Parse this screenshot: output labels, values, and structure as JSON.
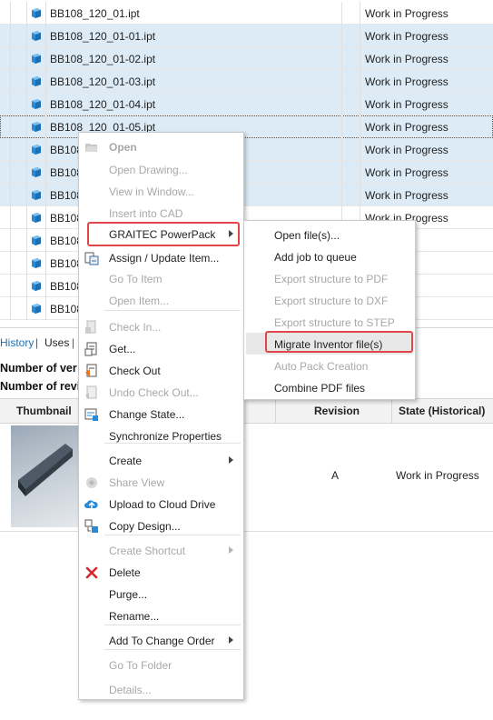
{
  "file_list": {
    "rows": [
      {
        "name": "BB108_120_01.ipt",
        "state": "Work in Progress",
        "selected": false
      },
      {
        "name": "BB108_120_01-01.ipt",
        "state": "Work in Progress",
        "selected": true
      },
      {
        "name": "BB108_120_01-02.ipt",
        "state": "Work in Progress",
        "selected": true
      },
      {
        "name": "BB108_120_01-03.ipt",
        "state": "Work in Progress",
        "selected": true
      },
      {
        "name": "BB108_120_01-04.ipt",
        "state": "Work in Progress",
        "selected": true
      },
      {
        "name": "BB108_120_01-05.ipt",
        "state": "Work in Progress",
        "selected": true
      },
      {
        "name": "BB108",
        "state": "Work in Progress",
        "selected": true
      },
      {
        "name": "BB108",
        "state": "Work in Progress",
        "selected": true
      },
      {
        "name": "BB108",
        "state": "Work in Progress",
        "selected": true
      },
      {
        "name": "BB108",
        "state": "Work in Progress",
        "selected": false
      },
      {
        "name": "BB108",
        "state": "ogress",
        "selected": false
      },
      {
        "name": "BB108",
        "state": "ogress",
        "selected": false
      },
      {
        "name": "BB108",
        "state": "ogress",
        "selected": false
      },
      {
        "name": "BB108",
        "state": "ogress",
        "selected": false
      }
    ],
    "icon_color": "#2b8ad6",
    "selected_color": "#dcebf6"
  },
  "tabs": {
    "history": "History",
    "sep1": "|",
    "uses": "Uses",
    "sep2": "|"
  },
  "info": {
    "versions_label": "Number of ver",
    "revisions_label": "Number of revi"
  },
  "history_table": {
    "headers": {
      "thumbnail": "Thumbnail",
      "revision": "Revision",
      "state": "State (Historical)"
    },
    "row": {
      "revision": "A",
      "state": "Work in Progress"
    }
  },
  "context_menu": {
    "items": [
      {
        "label": "Open",
        "disabled": true,
        "bold": true,
        "icon": "open-icon"
      },
      {
        "label": "Open Drawing...",
        "disabled": true
      },
      {
        "label": "View in Window...",
        "disabled": true
      },
      {
        "label": "Insert into CAD",
        "disabled": true
      },
      {
        "label": "GRAITEC PowerPack",
        "disabled": false,
        "submenu": true
      },
      {
        "label": "Assign / Update Item...",
        "disabled": false,
        "icon": "assign-item-icon"
      },
      {
        "label": "Go To Item",
        "disabled": true
      },
      {
        "label": "Open Item...",
        "disabled": true
      },
      {
        "label": "Check In...",
        "disabled": true,
        "icon": "check-in-icon"
      },
      {
        "label": "Get...",
        "disabled": false,
        "icon": "get-icon"
      },
      {
        "label": "Check Out",
        "disabled": false,
        "icon": "check-out-icon"
      },
      {
        "label": "Undo Check Out...",
        "disabled": true,
        "icon": "undo-check-out-icon"
      },
      {
        "label": "Change State...",
        "disabled": false,
        "icon": "change-state-icon"
      },
      {
        "label": "Synchronize Properties",
        "disabled": false
      },
      {
        "label": "Create",
        "disabled": false,
        "submenu": true
      },
      {
        "label": "Share View",
        "disabled": true,
        "icon": "share-view-icon"
      },
      {
        "label": "Upload to Cloud Drive",
        "disabled": false,
        "icon": "cloud-upload-icon"
      },
      {
        "label": "Copy Design...",
        "disabled": false,
        "icon": "copy-design-icon"
      },
      {
        "label": "Create Shortcut",
        "disabled": true,
        "submenu": true
      },
      {
        "label": "Delete",
        "disabled": false,
        "icon": "delete-icon"
      },
      {
        "label": "Purge...",
        "disabled": false
      },
      {
        "label": "Rename...",
        "disabled": false
      },
      {
        "label": "Add To Change Order",
        "disabled": false,
        "submenu": true
      },
      {
        "label": "Go To Folder",
        "disabled": true
      },
      {
        "label": "Details...",
        "disabled": true
      }
    ]
  },
  "submenu": {
    "items": [
      {
        "label": "Open file(s)...",
        "disabled": false
      },
      {
        "label": "Add job to queue",
        "disabled": false
      },
      {
        "label": "Export structure to PDF",
        "disabled": true
      },
      {
        "label": "Export structure to DXF",
        "disabled": true
      },
      {
        "label": "Export structure to STEP",
        "disabled": true
      },
      {
        "label": "Migrate Inventor file(s)",
        "disabled": false
      },
      {
        "label": "Auto Pack Creation",
        "disabled": true
      },
      {
        "label": "Combine PDF files",
        "disabled": false
      }
    ]
  },
  "highlight_color": "#e2464a"
}
